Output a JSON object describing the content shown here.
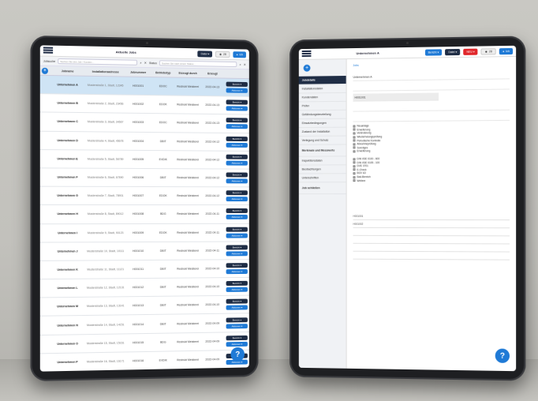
{
  "left_app": {
    "title": "Aktuelle Jobs",
    "header_buttons": {
      "dates": "Datei ▾",
      "count": "28",
      "user": "Ich"
    },
    "search": {
      "label1": "Jobsuche",
      "placeholder1": "Suchen Sie den Job / Kunden…",
      "label2": "Status",
      "placeholder2": "Suchen Sie nach einem Status…"
    },
    "columns": [
      "Jobname",
      "Installationsadresse",
      "Jobnummer",
      "Betriebstyp",
      "Erzeugt durch",
      "Erzeugt"
    ],
    "rows": [
      {
        "name": "Unternehmen A",
        "addr": "Musterstraße 1, Stadt, 12345",
        "num": "H001001",
        "type": "EDOC",
        "by": "Restrukt Meisterei",
        "date": "2022-04-13",
        "selected": true
      },
      {
        "name": "Unternehmen B",
        "addr": "Musterstraße 2, Stadt, 23456",
        "num": "H001002",
        "type": "EDOK",
        "by": "Restrukt Meisterei",
        "date": "2022-04-13",
        "selected": false
      },
      {
        "name": "Unternehmen C",
        "addr": "Musterstraße 3, Stadt, 34567",
        "num": "H001003",
        "type": "EDOC",
        "by": "Restrukt Meisterei",
        "date": "2022-04-13",
        "selected": false
      },
      {
        "name": "Unternehmen D",
        "addr": "Musterstraße 4, Stadt, 45678",
        "num": "H001004",
        "type": "DBIT",
        "by": "Restrukt Meisterei",
        "date": "2022-04-12",
        "selected": false
      },
      {
        "name": "Unternehmen E",
        "addr": "Musterstraße 5, Stadt, 56789",
        "num": "H001005",
        "type": "EVDIK",
        "by": "Restrukt Meisterei",
        "date": "2022-04-12",
        "selected": false
      },
      {
        "name": "Unternehmen F",
        "addr": "Musterstraße 6, Stadt, 67890",
        "num": "H001006",
        "type": "DBIT",
        "by": "Restrukt Meisterei",
        "date": "2022-04-12",
        "selected": false
      },
      {
        "name": "Unternehmen G",
        "addr": "Musterstraße 7, Stadt, 78901",
        "num": "H001007",
        "type": "EDOK",
        "by": "Restrukt Meisterei",
        "date": "2022-04-12",
        "selected": false
      },
      {
        "name": "Unternehmen H",
        "addr": "Musterstraße 8, Stadt, 89012",
        "num": "H001008",
        "type": "BDG",
        "by": "Restrukt Meisterei",
        "date": "2022-04-11",
        "selected": false
      },
      {
        "name": "Unternehmen I",
        "addr": "Musterstraße 9, Stadt, 90123",
        "num": "H001009",
        "type": "EDOK",
        "by": "Restrukt Meisterei",
        "date": "2022-04-11",
        "selected": false
      },
      {
        "name": "Unternehmen J",
        "addr": "Musterstraße 10, Stadt, 10111",
        "num": "H001010",
        "type": "DBIT",
        "by": "Restrukt Meisterei",
        "date": "2022-04-11",
        "selected": false
      },
      {
        "name": "Unternehmen K",
        "addr": "Musterstraße 11, Stadt, 11121",
        "num": "H001011",
        "type": "DBIT",
        "by": "Restrukt Meisterei",
        "date": "2022-04-10",
        "selected": false
      },
      {
        "name": "Unternehmen L",
        "addr": "Musterstraße 12, Stadt, 12131",
        "num": "H001012",
        "type": "DBIT",
        "by": "Restrukt Meisterei",
        "date": "2022-04-10",
        "selected": false
      },
      {
        "name": "Unternehmen M",
        "addr": "Musterstraße 13, Stadt, 13141",
        "num": "H001013",
        "type": "DBIT",
        "by": "Restrukt Meisterei",
        "date": "2022-04-10",
        "selected": false
      },
      {
        "name": "Unternehmen N",
        "addr": "Musterstraße 14, Stadt, 14151",
        "num": "H001014",
        "type": "DBIT",
        "by": "Restrukt Meisterei",
        "date": "2022-04-09",
        "selected": false
      },
      {
        "name": "Unternehmen O",
        "addr": "Musterstraße 15, Stadt, 15161",
        "num": "H001015",
        "type": "BDG",
        "by": "Restrukt Meisterei",
        "date": "2022-04-09",
        "selected": false
      },
      {
        "name": "Unternehmen P",
        "addr": "Musterstraße 16, Stadt, 16171",
        "num": "H001016",
        "type": "EVDIK",
        "by": "Restrukt Meisterei",
        "date": "2022-04-09",
        "selected": false
      }
    ],
    "action1": "Bericht ▾",
    "action2": "Aktionen ▾",
    "help": "?"
  },
  "right_app": {
    "title": "Unternehmen A",
    "header_buttons": {
      "report": "Bericht ▾",
      "dates": "Datei ▾",
      "alert": "NEU ▾",
      "count": "28",
      "user": "Ich"
    },
    "back_link": "Jobs",
    "sidebar": [
      "Jobdetails",
      "Installationsdaten",
      "Kundendaten",
      "Prüfer",
      "Gefährdungsbeurteilung",
      "Einsatzbedingungen",
      "Zustand der Installation",
      "Verlegung und Schutz",
      "Merkmale und Messwerte",
      "Inspektionsdaten",
      "Beobachtungen",
      "Unterschriften",
      "Job schließen"
    ],
    "fields": {
      "company": "Unternehmen A",
      "number": "H001001"
    },
    "checks_a": [
      "Neuanlage",
      "Erweiterung",
      "Veränderung",
      "Wiederholungsprüfung",
      "Periodische Kontrolle",
      "Abnahmeprüfung",
      "Sonstiges",
      "Erweiterung"
    ],
    "checks_b": [
      "DIN VDE 0100 - 600",
      "DIN VDE 0105 - 100",
      "DVE 0701",
      "E-Check",
      "BGV A3",
      "Bad-Bereich",
      "Weitere"
    ],
    "lower_fields": [
      "H001001",
      "H001002"
    ],
    "help": "?"
  }
}
